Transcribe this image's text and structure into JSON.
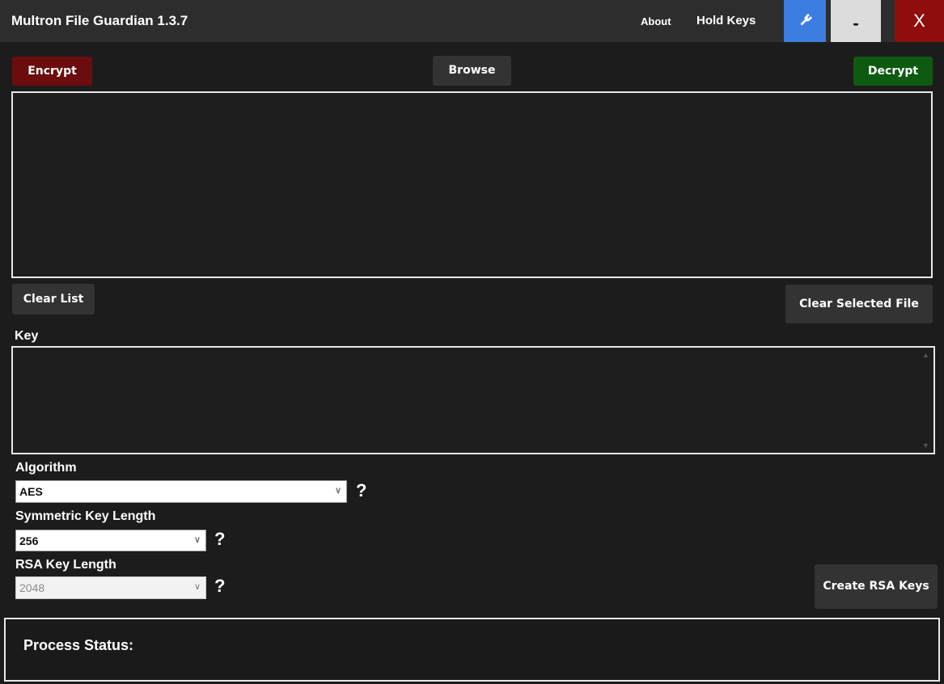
{
  "window": {
    "title": "Multron File Guardian 1.3.7",
    "menu": {
      "about": "About",
      "hold_keys": "Hold Keys"
    },
    "controls": {
      "settings_icon": "wrench-icon",
      "minimize": "-",
      "close": "X"
    },
    "colors": {
      "titlebar": "#2d2d2d",
      "settings": "#3b7de0",
      "minimize": "#dcdcdc",
      "close": "#8e0d0d"
    }
  },
  "actions": {
    "encrypt": "Encrypt",
    "browse": "Browse",
    "decrypt": "Decrypt",
    "clear_list": "Clear List",
    "clear_selected": "Clear Selected File",
    "create_rsa": "Create RSA Keys",
    "colors": {
      "encrypt": "#6b0d0d",
      "decrypt": "#0d5a10"
    }
  },
  "file_list": {
    "items": []
  },
  "key": {
    "label": "Key",
    "value": ""
  },
  "settings": {
    "algorithm": {
      "label": "Algorithm",
      "value": "AES",
      "help": "?"
    },
    "symmetric_key_length": {
      "label": "Symmetric Key Length",
      "value": "256",
      "help": "?"
    },
    "rsa_key_length": {
      "label": "RSA Key Length",
      "value": "2048",
      "help": "?",
      "disabled": true
    }
  },
  "status": {
    "label": "Process Status:"
  }
}
